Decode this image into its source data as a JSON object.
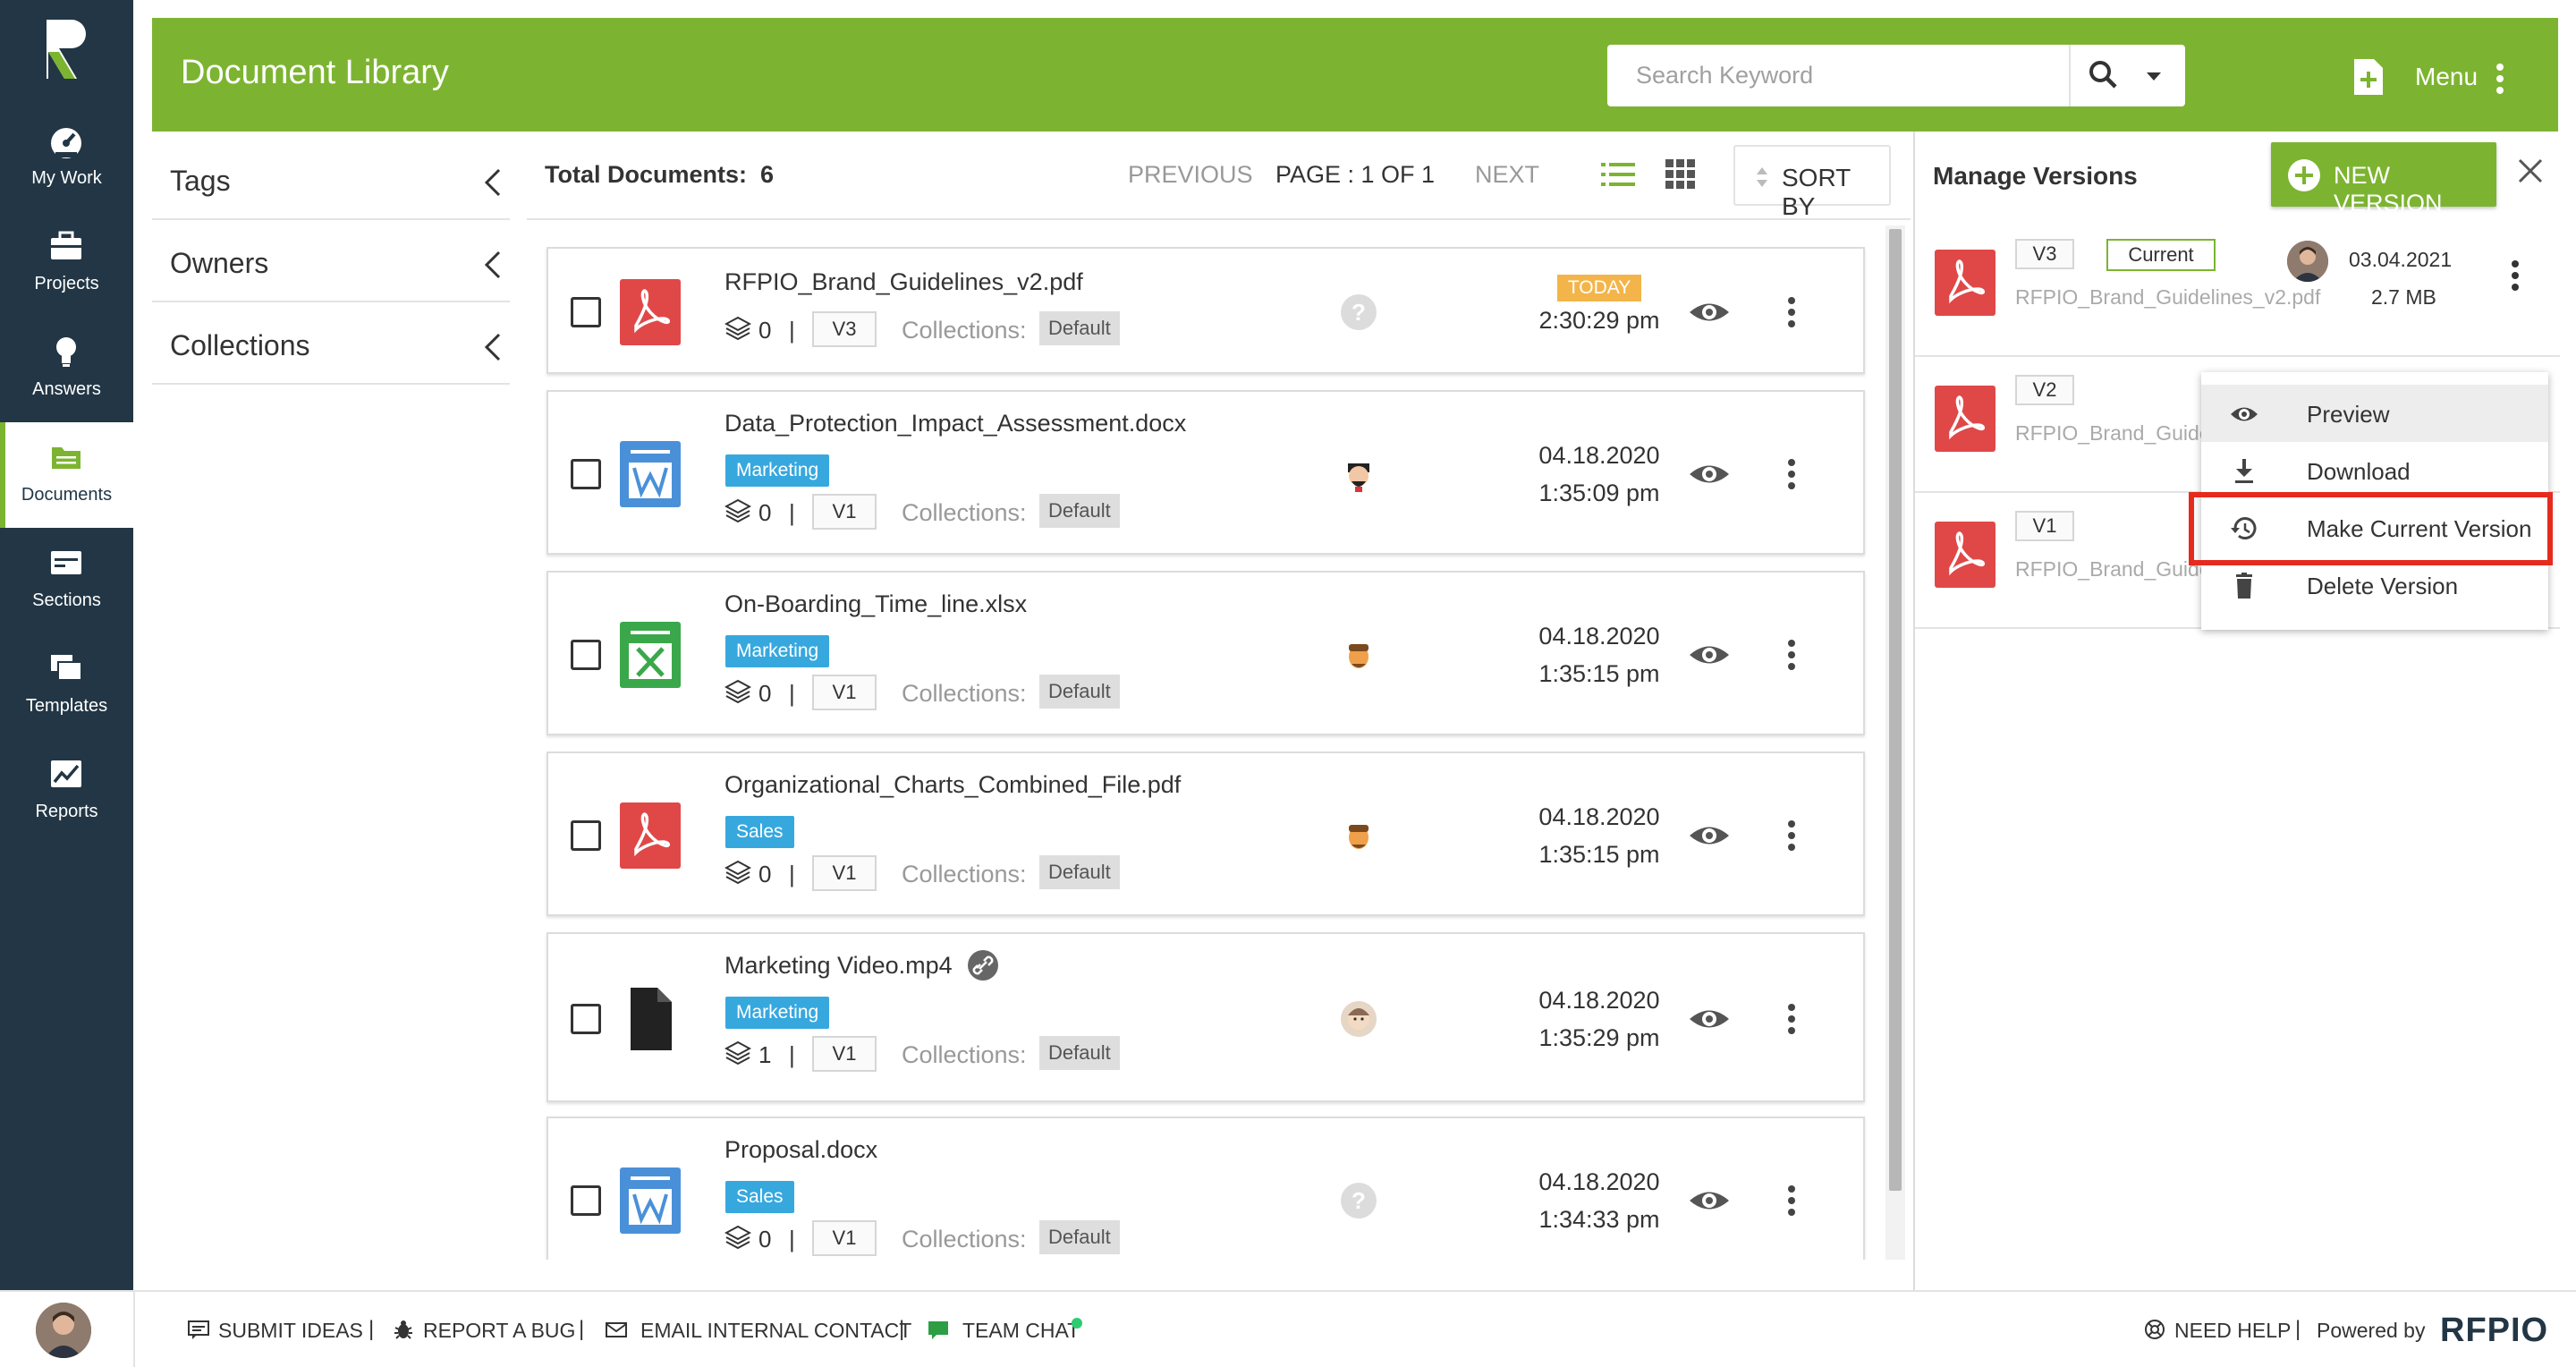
{
  "nav": {
    "items": [
      {
        "label": "My Work",
        "icon": "speedometer-icon"
      },
      {
        "label": "Projects",
        "icon": "briefcase-icon"
      },
      {
        "label": "Answers",
        "icon": "lightbulb-icon"
      },
      {
        "label": "Documents",
        "icon": "documents-icon",
        "active": true
      },
      {
        "label": "Sections",
        "icon": "sections-icon"
      },
      {
        "label": "Templates",
        "icon": "templates-icon"
      },
      {
        "label": "Reports",
        "icon": "reports-icon"
      }
    ]
  },
  "header": {
    "title": "Document Library",
    "search_placeholder": "Search Keyword",
    "menu_label": "Menu"
  },
  "filters": [
    "Tags",
    "Owners",
    "Collections"
  ],
  "list": {
    "total_label": "Total Documents:",
    "total_value": "6",
    "prev_label": "PREVIOUS",
    "page_label": "PAGE : 1 OF 1",
    "next_label": "NEXT",
    "sort_label": "SORT BY",
    "collections_label": "Collections:"
  },
  "documents": [
    {
      "name": "RFPIO_Brand_Guidelines_v2.pdf",
      "type": "pdf",
      "tag": "",
      "count": "0",
      "version": "V3",
      "collection": "Default",
      "owner": "unknown",
      "badge": "TODAY",
      "date": "",
      "time": "2:30:29 pm"
    },
    {
      "name": "Data_Protection_Impact_Assessment.docx",
      "type": "docx",
      "tag": "Marketing",
      "count": "0",
      "version": "V1",
      "collection": "Default",
      "owner": "avatar-a",
      "badge": "",
      "date": "04.18.2020",
      "time": "1:35:09 pm"
    },
    {
      "name": "On-Boarding_Time_line.xlsx",
      "type": "xlsx",
      "tag": "Marketing",
      "count": "0",
      "version": "V1",
      "collection": "Default",
      "owner": "avatar-b",
      "badge": "",
      "date": "04.18.2020",
      "time": "1:35:15 pm"
    },
    {
      "name": "Organizational_Charts_Combined_File.pdf",
      "type": "pdf",
      "tag": "Sales",
      "count": "0",
      "version": "V1",
      "collection": "Default",
      "owner": "avatar-b",
      "badge": "",
      "date": "04.18.2020",
      "time": "1:35:15 pm"
    },
    {
      "name": "Marketing Video.mp4",
      "type": "file",
      "tag": "Marketing",
      "count": "1",
      "version": "V1",
      "collection": "Default",
      "owner": "avatar-c",
      "badge": "",
      "date": "04.18.2020",
      "time": "1:35:29 pm",
      "linked": true
    },
    {
      "name": "Proposal.docx",
      "type": "docx",
      "tag": "Sales",
      "count": "0",
      "version": "V1",
      "collection": "Default",
      "owner": "unknown",
      "badge": "",
      "date": "04.18.2020",
      "time": "1:34:33 pm"
    }
  ],
  "versions_panel": {
    "title": "Manage Versions",
    "new_version_label": "NEW VERSION",
    "current_label": "Current",
    "versions": [
      {
        "version": "V3",
        "file": "RFPIO_Brand_Guidelines_v2.pdf",
        "current": true,
        "date": "03.04.2021",
        "size": "2.7 MB"
      },
      {
        "version": "V2",
        "file": "RFPIO_Brand_Guidel",
        "current": false
      },
      {
        "version": "V1",
        "file": "RFPIO_Brand_Guidel",
        "current": false
      }
    ]
  },
  "context_menu": {
    "items": [
      {
        "label": "Preview",
        "icon": "eye-icon"
      },
      {
        "label": "Download",
        "icon": "download-icon"
      },
      {
        "label": "Make Current Version",
        "icon": "history-icon",
        "highlighted": true
      },
      {
        "label": "Delete Version",
        "icon": "trash-icon"
      }
    ]
  },
  "footer": {
    "submit_ideas": "SUBMIT IDEAS",
    "report_bug": "REPORT A BUG",
    "email_contact": "EMAIL INTERNAL CONTACT",
    "team_chat": "TEAM CHAT",
    "need_help": "NEED HELP",
    "powered_by": "Powered by",
    "brand": "RFPIO"
  },
  "colors": {
    "brand_green": "#7cb431",
    "nav_bg": "#223645",
    "tag_blue": "#37a8de",
    "today_badge": "#f3b54a",
    "pdf_red": "#e04848",
    "doc_blue": "#4a90d9",
    "xls_green": "#3aa84a",
    "highlight_red": "#e62b1e"
  }
}
